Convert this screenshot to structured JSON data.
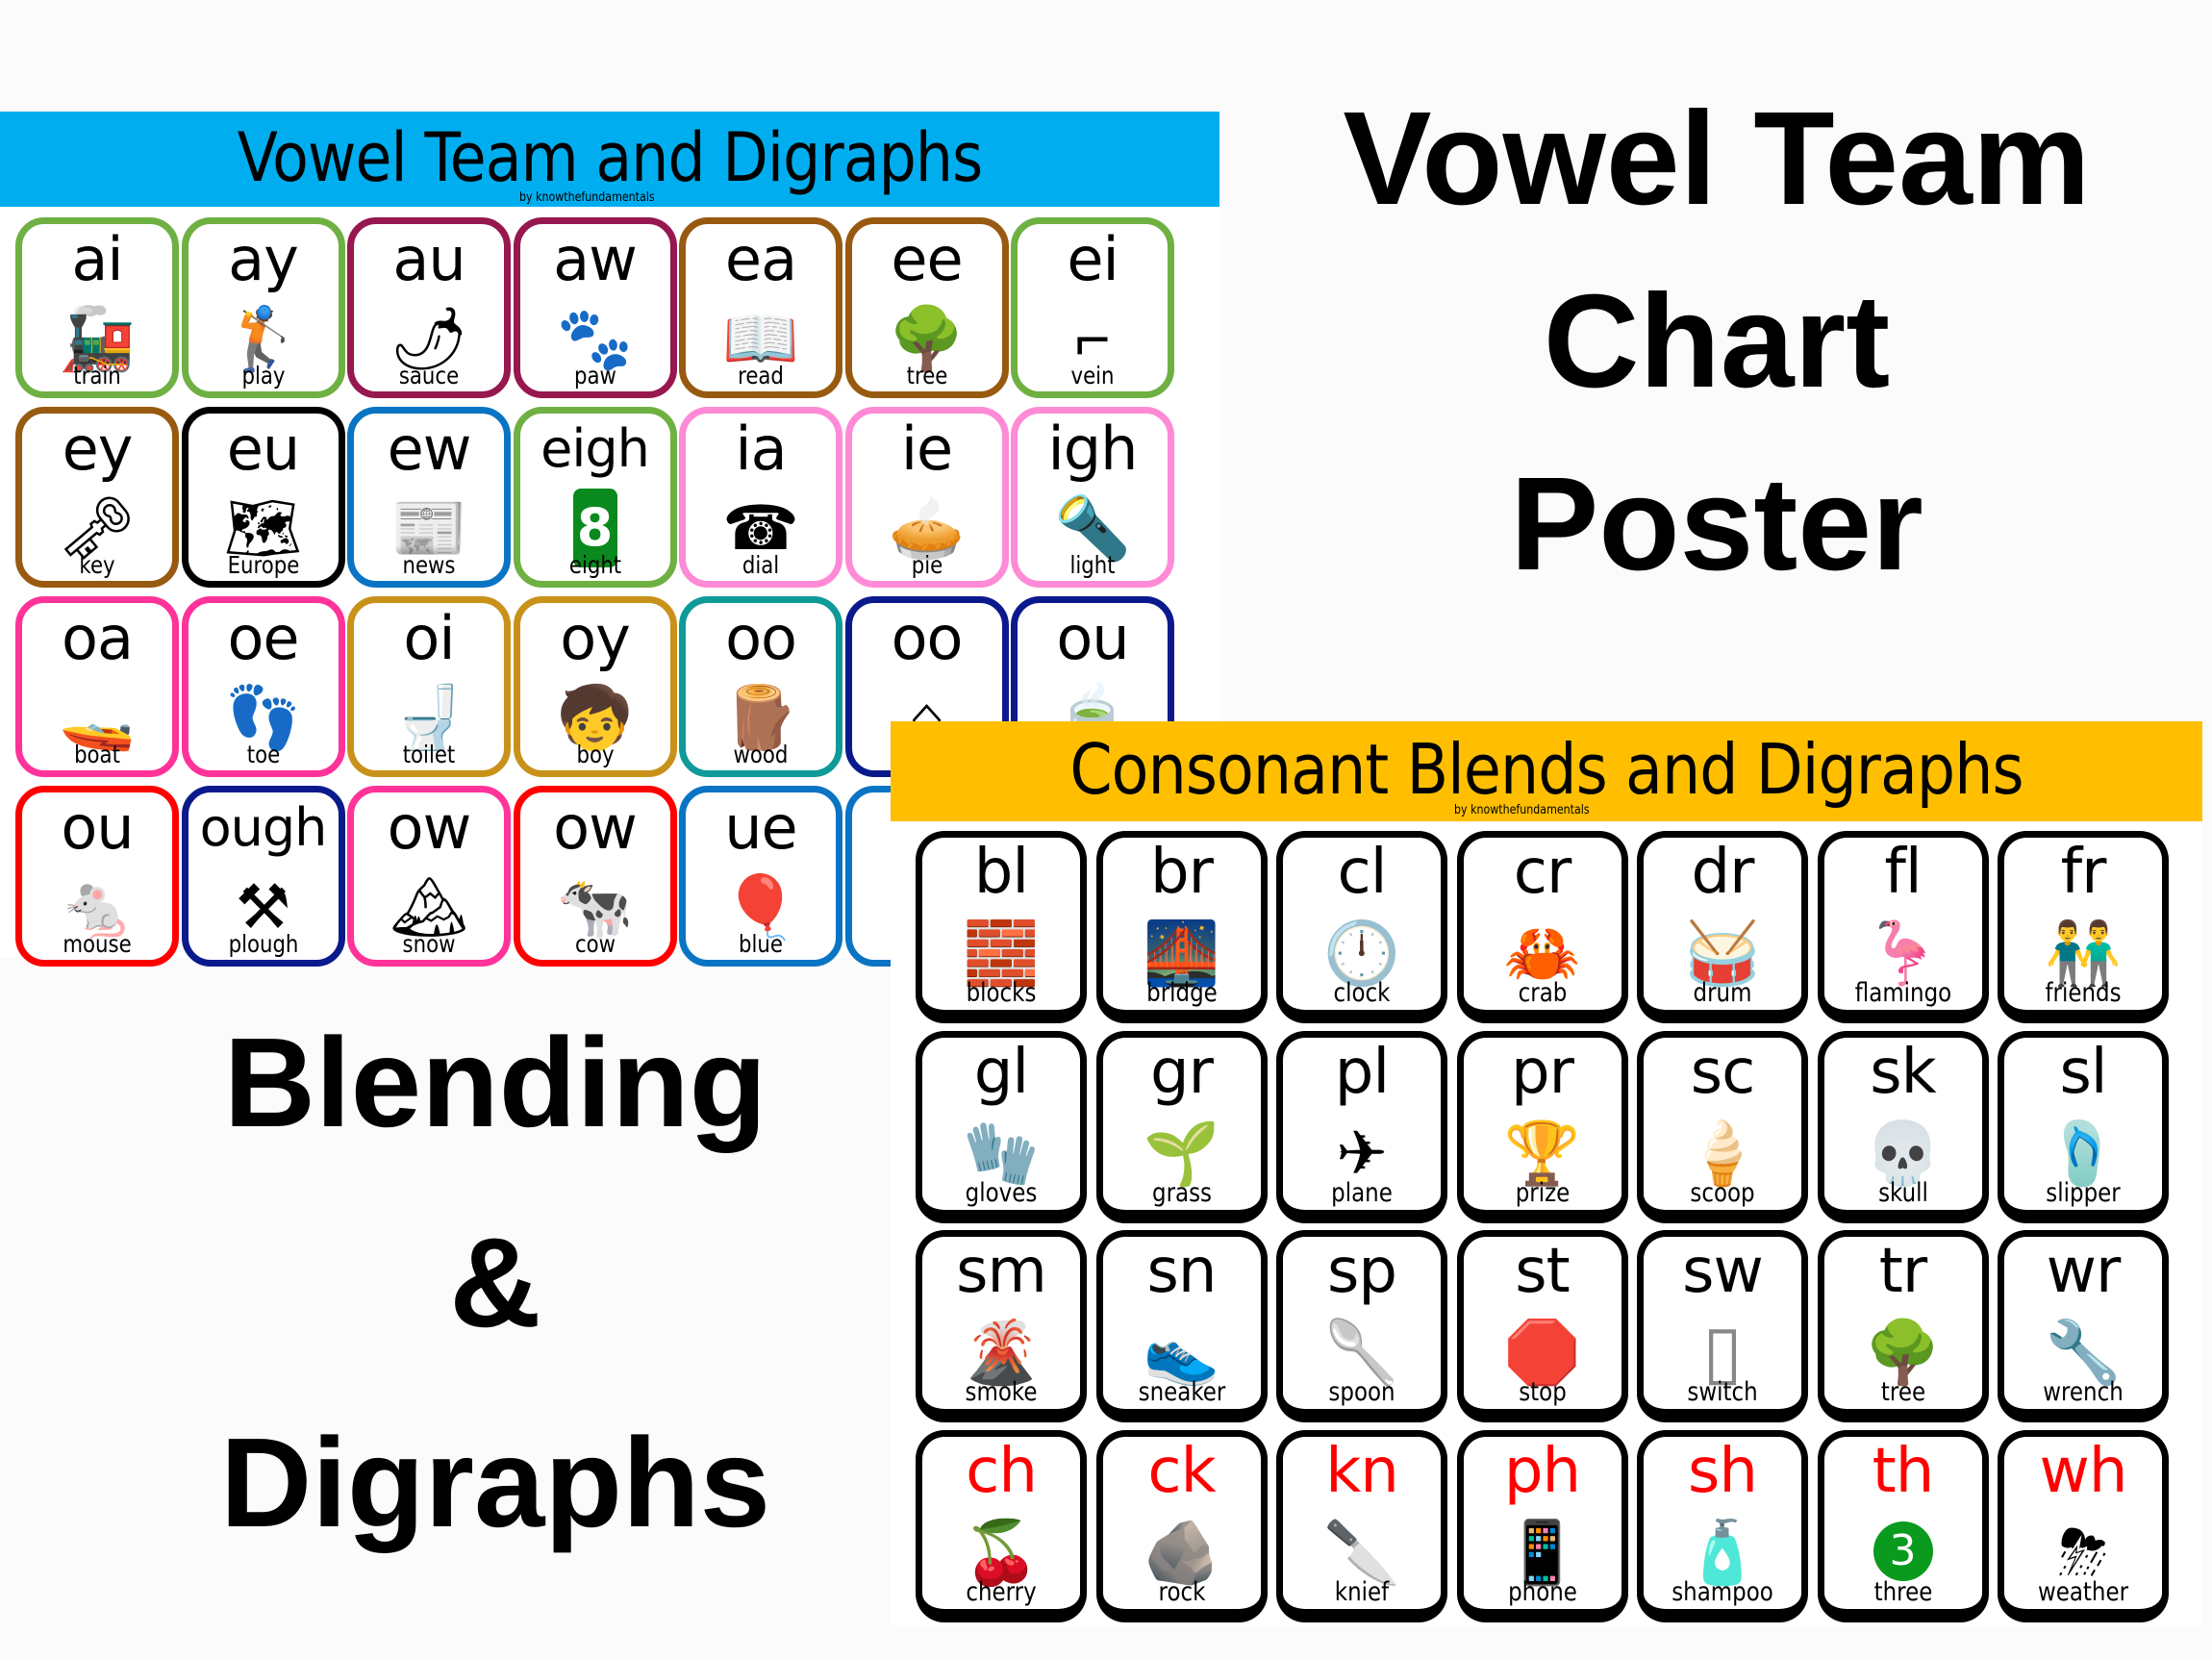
{
  "vowel_poster": {
    "title": "Vowel Team and Digraphs",
    "byline": "by knowthefundamentals",
    "header_color": "#00aeef",
    "cards": [
      {
        "letters": "ai",
        "word": "train",
        "icon": "train-icon",
        "glyph": "🚂",
        "border": "#6fb043"
      },
      {
        "letters": "ay",
        "word": "play",
        "icon": "golfer-icon",
        "glyph": "🏌",
        "border": "#6fb043"
      },
      {
        "letters": "au",
        "word": "sauce",
        "icon": "sauce-bottle-icon",
        "glyph": "🌶",
        "border": "#97174f"
      },
      {
        "letters": "aw",
        "word": "paw",
        "icon": "paw-print-icon",
        "glyph": "🐾",
        "border": "#97174f"
      },
      {
        "letters": "ea",
        "word": "read",
        "icon": "girl-reading-book-icon",
        "glyph": "📖",
        "border": "#985a10"
      },
      {
        "letters": "ee",
        "word": "tree",
        "icon": "tree-icon",
        "glyph": "🌳",
        "border": "#985a10"
      },
      {
        "letters": "ei",
        "word": "vein",
        "icon": "vein-tube-icon",
        "glyph": "⌐",
        "border": "#6fb043"
      },
      {
        "letters": "ey",
        "word": "key",
        "icon": "key-icon",
        "glyph": "🗝",
        "border": "#985a10"
      },
      {
        "letters": "eu",
        "word": "Europe",
        "icon": "europe-map-icon",
        "glyph": "🗺",
        "border": "#000000"
      },
      {
        "letters": "ew",
        "word": "news",
        "icon": "newspaper-icon",
        "glyph": "📰",
        "border": "#0a74c4"
      },
      {
        "letters": "eigh",
        "word": "eight",
        "icon": "number-eight-icon",
        "glyph": "8",
        "border": "#6fb043"
      },
      {
        "letters": "ia",
        "word": "dial",
        "icon": "rotary-phone-icon",
        "glyph": "☎",
        "border": "#ff8ad6"
      },
      {
        "letters": "ie",
        "word": "pie",
        "icon": "pie-slice-icon",
        "glyph": "🥧",
        "border": "#ff8ad6"
      },
      {
        "letters": "igh",
        "word": "light",
        "icon": "spotlight-icon",
        "glyph": "🔦",
        "border": "#ff8ad6"
      },
      {
        "letters": "oa",
        "word": "boat",
        "icon": "boat-icon",
        "glyph": "🚤",
        "border": "#ff3399"
      },
      {
        "letters": "oe",
        "word": "toe",
        "icon": "feet-toes-icon",
        "glyph": "👣",
        "border": "#ff3399"
      },
      {
        "letters": "oi",
        "word": "toilet",
        "icon": "toilet-icon",
        "glyph": "🚽",
        "border": "#c8921a"
      },
      {
        "letters": "oy",
        "word": "boy",
        "icon": "boy-icon",
        "glyph": "🧒",
        "border": "#c8921a"
      },
      {
        "letters": "oo",
        "word": "wood",
        "icon": "wood-plank-icon",
        "glyph": "🪵",
        "border": "#0f9a98"
      },
      {
        "letters": "oo",
        "word": "",
        "icon": "roof-icon",
        "glyph": "⌂",
        "border": "#0a1a8c"
      },
      {
        "letters": "ou",
        "word": "",
        "icon": "soup-bowl-icon",
        "glyph": "🍵",
        "border": "#0a1a8c"
      },
      {
        "letters": "ou",
        "word": "mouse",
        "icon": "mouse-icon",
        "glyph": "🐁",
        "border": "#ff0000"
      },
      {
        "letters": "ough",
        "word": "plough",
        "icon": "plough-icon",
        "glyph": "⚒",
        "border": "#0a1a8c"
      },
      {
        "letters": "ow",
        "word": "snow",
        "icon": "snowy-rocks-icon",
        "glyph": "🏔",
        "border": "#ff3399"
      },
      {
        "letters": "ow",
        "word": "cow",
        "icon": "cow-icon",
        "glyph": "🐄",
        "border": "#ff0000"
      },
      {
        "letters": "ue",
        "word": "blue",
        "icon": "blue-balloon-icon",
        "glyph": "🎈",
        "border": "#0a74c4"
      },
      {
        "letters": "",
        "word": "",
        "icon": "hidden-card",
        "glyph": "",
        "border": "#0a74c4"
      }
    ]
  },
  "consonant_poster": {
    "title": "Consonant Blends and Digraphs",
    "byline": "by knowthefundamentals",
    "header_color": "#ffbf00",
    "digraph_color": "#ff0000",
    "cards": [
      {
        "letters": "bl",
        "word": "blocks",
        "icon": "toy-blocks-icon",
        "glyph": "🧱",
        "digraph": false
      },
      {
        "letters": "br",
        "word": "bridge",
        "icon": "bridge-icon",
        "glyph": "🌉",
        "digraph": false
      },
      {
        "letters": "cl",
        "word": "clock",
        "icon": "clock-icon",
        "glyph": "🕛",
        "digraph": false
      },
      {
        "letters": "cr",
        "word": "crab",
        "icon": "crab-icon",
        "glyph": "🦀",
        "digraph": false
      },
      {
        "letters": "dr",
        "word": "drum",
        "icon": "drum-icon",
        "glyph": "🥁",
        "digraph": false
      },
      {
        "letters": "fl",
        "word": "flamingo",
        "icon": "flamingo-icon",
        "glyph": "🦩",
        "digraph": false
      },
      {
        "letters": "fr",
        "word": "friends",
        "icon": "friends-icon",
        "glyph": "👬",
        "digraph": false
      },
      {
        "letters": "gl",
        "word": "gloves",
        "icon": "gloves-icon",
        "glyph": "🧤",
        "digraph": false
      },
      {
        "letters": "gr",
        "word": "grass",
        "icon": "grass-icon",
        "glyph": "🌱",
        "digraph": false
      },
      {
        "letters": "pl",
        "word": "plane",
        "icon": "plane-icon",
        "glyph": "✈",
        "digraph": false
      },
      {
        "letters": "pr",
        "word": "prize",
        "icon": "trophy-medal-icon",
        "glyph": "🏆",
        "digraph": false
      },
      {
        "letters": "sc",
        "word": "scoop",
        "icon": "ice-cream-cone-icon",
        "glyph": "🍦",
        "digraph": false
      },
      {
        "letters": "sk",
        "word": "skull",
        "icon": "skull-icon",
        "glyph": "💀",
        "digraph": false
      },
      {
        "letters": "sl",
        "word": "slipper",
        "icon": "slippers-icon",
        "glyph": "🩴",
        "digraph": false
      },
      {
        "letters": "sm",
        "word": "smoke",
        "icon": "volcano-smoke-icon",
        "glyph": "🌋",
        "digraph": false
      },
      {
        "letters": "sn",
        "word": "sneaker",
        "icon": "sneaker-icon",
        "glyph": "👟",
        "digraph": false
      },
      {
        "letters": "sp",
        "word": "spoon",
        "icon": "spoon-icon",
        "glyph": "🥄",
        "digraph": false
      },
      {
        "letters": "st",
        "word": "stop",
        "icon": "stop-sign-icon",
        "glyph": "🛑",
        "digraph": false
      },
      {
        "letters": "sw",
        "word": "switch",
        "icon": "light-switch-icon",
        "glyph": "▯",
        "digraph": false
      },
      {
        "letters": "tr",
        "word": "tree",
        "icon": "tree-icon",
        "glyph": "🌳",
        "digraph": false
      },
      {
        "letters": "wr",
        "word": "wrench",
        "icon": "wrench-icon",
        "glyph": "🔧",
        "digraph": false
      },
      {
        "letters": "ch",
        "word": "cherry",
        "icon": "cherry-icon",
        "glyph": "🍒",
        "digraph": true
      },
      {
        "letters": "ck",
        "word": "rock",
        "icon": "rock-icon",
        "glyph": "🪨",
        "digraph": true
      },
      {
        "letters": "kn",
        "word": "knief",
        "icon": "cleaver-knife-icon",
        "glyph": "🔪",
        "digraph": true
      },
      {
        "letters": "ph",
        "word": "phone",
        "icon": "smartphone-icon",
        "glyph": "📱",
        "digraph": true
      },
      {
        "letters": "sh",
        "word": "shampoo",
        "icon": "shampoo-bottle-icon",
        "glyph": "🧴",
        "digraph": true
      },
      {
        "letters": "th",
        "word": "three",
        "icon": "number-three-icon",
        "glyph": "3",
        "digraph": true
      },
      {
        "letters": "wh",
        "word": "weather",
        "icon": "storm-cloud-icon",
        "glyph": "⛈",
        "digraph": true
      }
    ]
  },
  "headlines": {
    "vowel": [
      "Vowel Team",
      "Chart",
      "Poster"
    ],
    "blending": [
      "Blending",
      "&",
      "Digraphs"
    ]
  }
}
